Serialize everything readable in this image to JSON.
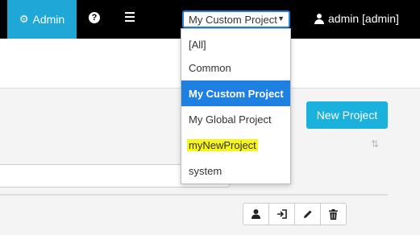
{
  "navbar": {
    "admin_label": "Admin",
    "help_icon": "?",
    "menu_icon": "hamburger-icon",
    "user_label": "admin [admin]"
  },
  "project_select": {
    "selected": "My Custom Project",
    "arrow": "▼",
    "options": [
      {
        "label": "[All]"
      },
      {
        "label": "Common"
      },
      {
        "label": "My Custom Project",
        "selected": true
      },
      {
        "label": "My Global Project"
      },
      {
        "label": "myNewProject",
        "highlighted": true
      },
      {
        "label": "system"
      }
    ]
  },
  "main": {
    "new_project_label": "New Project",
    "filter_value": ""
  },
  "actions": [
    {
      "icon": "user-icon"
    },
    {
      "icon": "login-icon"
    },
    {
      "icon": "pencil-icon"
    },
    {
      "icon": "trash-icon"
    }
  ],
  "colors": {
    "navbar_bg": "#000000",
    "admin_tab_bg": "#1fa8d7",
    "selected_option_bg": "#1e80e0",
    "new_project_bg": "#1ab2dd",
    "highlight": "#f5f51a"
  }
}
